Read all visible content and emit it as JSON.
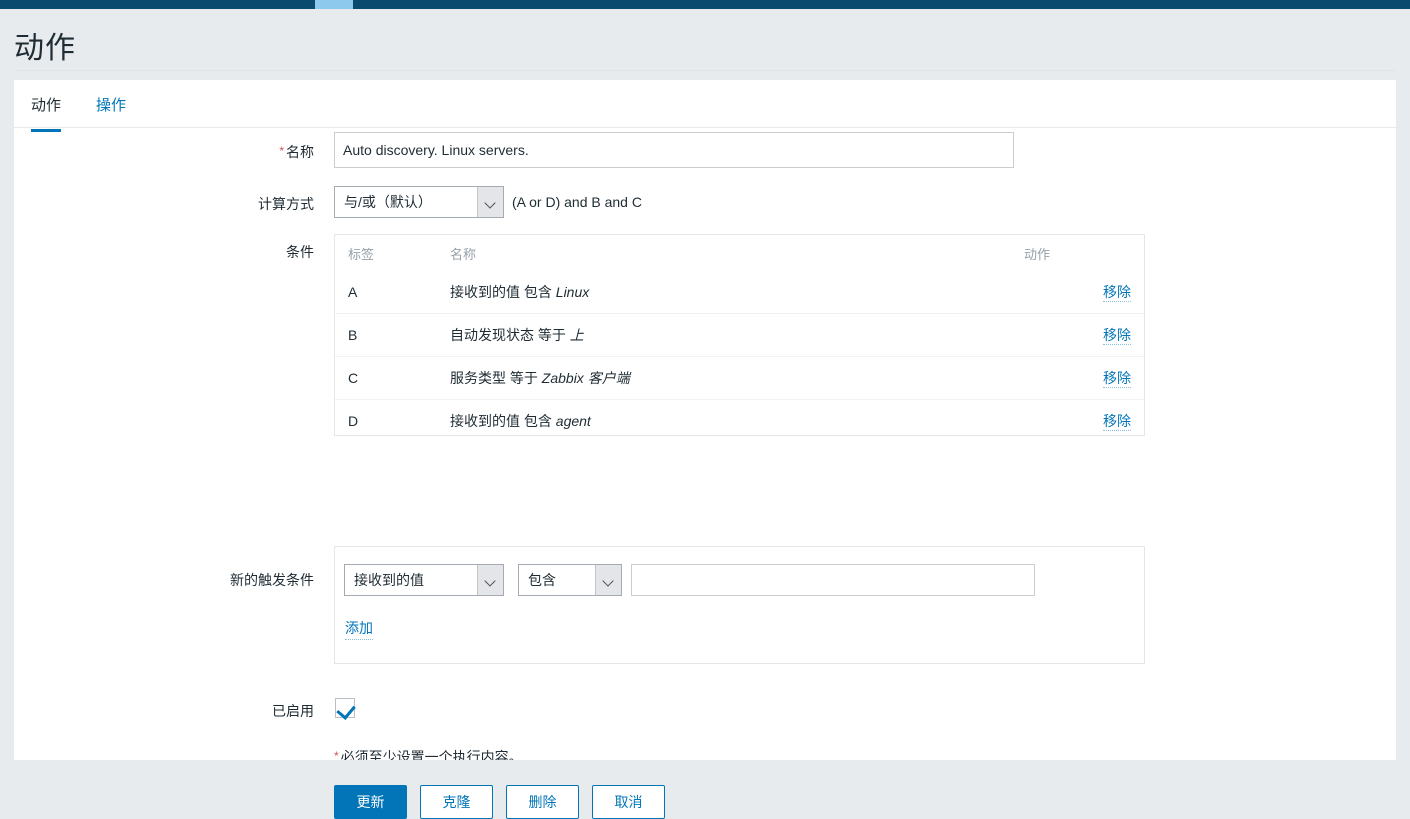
{
  "topbar": {
    "active_item": ""
  },
  "header": {
    "title": "动作"
  },
  "tabs": [
    {
      "label": "动作",
      "active": true
    },
    {
      "label": "操作",
      "active": false
    }
  ],
  "form": {
    "name": {
      "label": "名称",
      "required": true,
      "value": "Auto discovery. Linux servers.",
      "placeholder": ""
    },
    "calculation": {
      "label": "计算方式",
      "selected": "与/或（默认）",
      "formula": "(A or D) and B and C"
    },
    "conditions": {
      "label": "条件",
      "columns": {
        "label": "标签",
        "name": "名称",
        "action": "动作"
      },
      "rows": [
        {
          "label": "A",
          "prefix": "接收到的值 包含 ",
          "value": "Linux",
          "action": "移除"
        },
        {
          "label": "B",
          "prefix": "自动发现状态 等于 ",
          "value": "上",
          "action": "移除"
        },
        {
          "label": "C",
          "prefix": "服务类型 等于 ",
          "value": "Zabbix 客户端",
          "action": "移除"
        },
        {
          "label": "D",
          "prefix": "接收到的值 包含 ",
          "value": "agent",
          "action": "移除"
        }
      ]
    },
    "new_condition": {
      "label": "新的触发条件",
      "type_selected": "接收到的值",
      "operator_selected": "包含",
      "value": "",
      "value_placeholder": "",
      "add_label": "添加"
    },
    "enabled": {
      "label": "已启用",
      "checked": true
    },
    "required_note": "必须至少设置一个执行内容。"
  },
  "buttons": {
    "update": "更新",
    "clone": "克隆",
    "delete": "删除",
    "cancel": "取消"
  },
  "colors": {
    "navy": "#0a4a6e",
    "accent": "#0275b8",
    "highlight": "#8cc9ed",
    "required": "#d45353",
    "page_bg": "#e8ebee"
  }
}
